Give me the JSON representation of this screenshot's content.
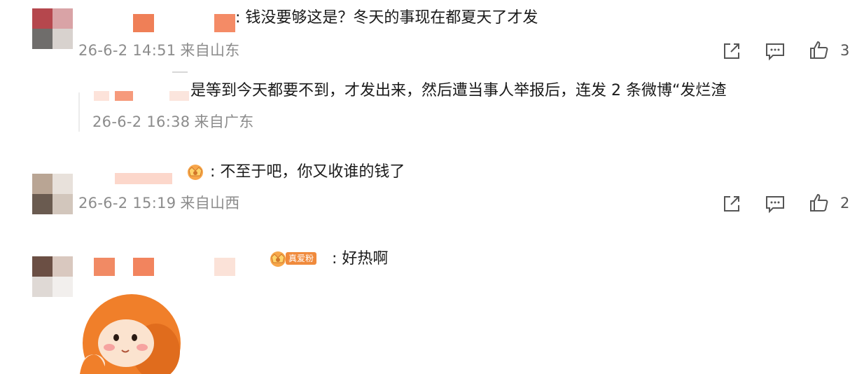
{
  "comments": [
    {
      "text": ": 钱没要够这是？冬天的事现在都夏天了才发",
      "date": "26-6-2 14:51",
      "source": "来自山东",
      "like_count": "3",
      "reply": {
        "text": "是等到今天都要不到，才发出来，然后遭当事人举报后，连发 2 条微博“发烂渣",
        "date": "26-6-2 16:38",
        "source": "来自广东"
      }
    },
    {
      "text": ": 不至于吧，你又收谁的钱了",
      "date": "26-6-2 15:19",
      "source": "来自山西",
      "like_count": "2"
    },
    {
      "text": ": 好热啊",
      "badge_text": "真爱粉"
    }
  ],
  "icons": {
    "share": "share-icon",
    "comment": "comment-icon",
    "like": "thumbs-up-icon"
  },
  "colors": {
    "meta_text": "#8c8c8c",
    "badge_orange": "#f08a3c",
    "sticker_orange": "#f07f2a"
  }
}
